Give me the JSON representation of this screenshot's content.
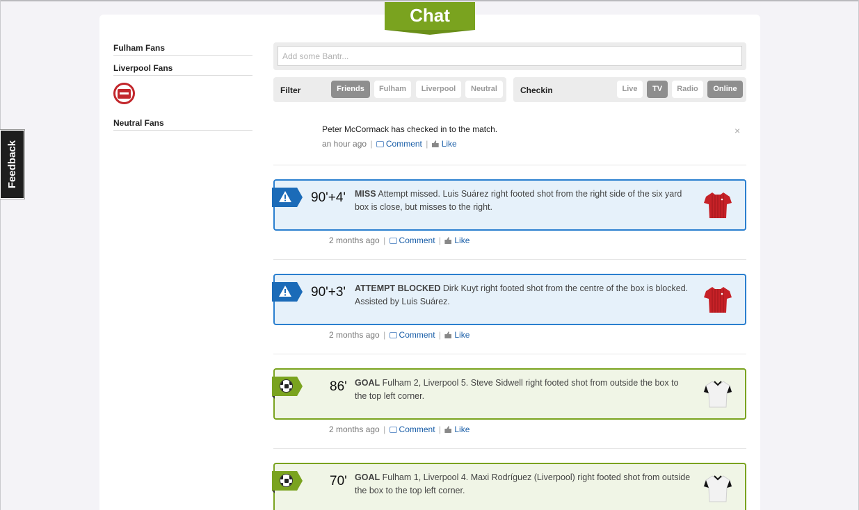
{
  "feedback_label": "Feedback",
  "chat_title": "Chat",
  "fans": {
    "fulham": "Fulham Fans",
    "liverpool": "Liverpool Fans",
    "neutral": "Neutral Fans"
  },
  "bantr_placeholder": "Add some Bantr...",
  "filter": {
    "label": "Filter",
    "options": [
      "Friends",
      "Fulham",
      "Liverpool",
      "Neutral"
    ],
    "active": "Friends"
  },
  "checkin": {
    "label": "Checkin",
    "options": [
      "Live",
      "TV",
      "Radio",
      "Online"
    ],
    "active": [
      "TV",
      "Online"
    ]
  },
  "feed": {
    "checkin_post": {
      "text": "Peter McCormack has checked in to the match.",
      "time": "an hour ago",
      "close": "×"
    },
    "comment_label": "Comment",
    "like_label": "Like",
    "separator": "|",
    "events": [
      {
        "type": "miss",
        "color": "#2a7fcf",
        "minute": "90'+4'",
        "title": "MISS",
        "text": "Attempt missed. Luis Suárez right footed shot from the right side of the six yard box is close, but misses to the right.",
        "time": "2 months ago",
        "team_shirt": "liverpool-red"
      },
      {
        "type": "attempt-blocked",
        "color": "#2a7fcf",
        "minute": "90'+3'",
        "title": "ATTEMPT BLOCKED",
        "text": "Dirk Kuyt right footed shot from the centre of the box is blocked. Assisted by Luis Suárez.",
        "time": "2 months ago",
        "team_shirt": "liverpool-red"
      },
      {
        "type": "goal",
        "color": "#7aa31f",
        "minute": "86'",
        "title": "GOAL",
        "text": "Fulham 2, Liverpool 5. Steve Sidwell right footed shot from outside the box to the top left corner.",
        "time": "2 months ago",
        "team_shirt": "fulham-white"
      },
      {
        "type": "goal",
        "color": "#7aa31f",
        "minute": "70'",
        "title": "GOAL",
        "text": "Fulham 1, Liverpool 4. Maxi Rodríguez (Liverpool) right footed shot from outside the box to the top left corner.",
        "team_shirt": "fulham-white"
      }
    ]
  }
}
